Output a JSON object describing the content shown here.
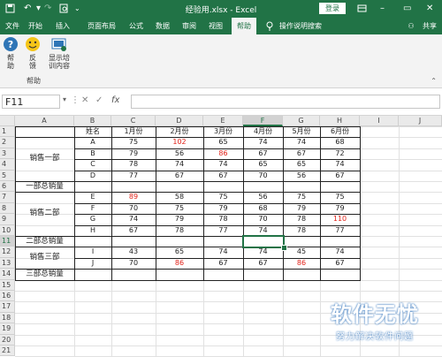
{
  "window": {
    "title": "经验用.xlsx  -  Excel",
    "login_label": "登录",
    "icons": [
      "save-icon",
      "undo-icon",
      "redo-icon",
      "print-preview-icon",
      "customize-icon"
    ]
  },
  "menu": {
    "tabs": [
      "文件",
      "开始",
      "插入",
      "页面布局",
      "公式",
      "数据",
      "审阅",
      "视图",
      "帮助",
      "操作说明搜索"
    ],
    "active": "帮助",
    "share_label": "共享"
  },
  "ribbon": {
    "buttons": [
      {
        "label": "帮\n助",
        "icon": "help-icon"
      },
      {
        "label": "反\n馈",
        "icon": "smiley-icon"
      },
      {
        "label": "显示培\n训内容",
        "icon": "training-icon"
      }
    ],
    "group_label": "帮助"
  },
  "formula_bar": {
    "name_box": "F11",
    "fx_label": "fx",
    "value": ""
  },
  "grid": {
    "columns": [
      "A",
      "B",
      "C",
      "D",
      "E",
      "F",
      "G",
      "H",
      "I",
      "J"
    ],
    "selected_column": "F",
    "rows": [
      "1",
      "2",
      "3",
      "4",
      "5",
      "6",
      "7",
      "8",
      "9",
      "10",
      "11",
      "12",
      "13",
      "14",
      "15",
      "16",
      "17",
      "18",
      "19",
      "20",
      "21"
    ],
    "selected_row": "11",
    "selected_cell": "F11"
  },
  "table": {
    "header": [
      "姓名",
      "1月份",
      "2月份",
      "3月份",
      "4月份",
      "5月份",
      "6月份"
    ],
    "departments": [
      {
        "name": "销售一部",
        "total_label": "一部总销量"
      },
      {
        "name": "销售二部",
        "total_label": "二部总销量"
      },
      {
        "name": "销售三部",
        "total_label": "三部总销量"
      }
    ],
    "rows": [
      {
        "r": 2,
        "name": "A",
        "values": [
          "75",
          "102",
          "65",
          "74",
          "74",
          "68"
        ],
        "red": [
          1
        ]
      },
      {
        "r": 3,
        "name": "B",
        "values": [
          "79",
          "56",
          "86",
          "67",
          "67",
          "72"
        ],
        "red": [
          2
        ]
      },
      {
        "r": 4,
        "name": "C",
        "values": [
          "78",
          "74",
          "74",
          "65",
          "65",
          "74"
        ],
        "red": []
      },
      {
        "r": 5,
        "name": "D",
        "values": [
          "77",
          "67",
          "67",
          "70",
          "56",
          "67"
        ],
        "red": []
      },
      {
        "r": 7,
        "name": "E",
        "values": [
          "89",
          "58",
          "75",
          "56",
          "75",
          "75"
        ],
        "red": [
          0
        ]
      },
      {
        "r": 8,
        "name": "F",
        "values": [
          "70",
          "75",
          "79",
          "68",
          "79",
          "79"
        ],
        "red": []
      },
      {
        "r": 9,
        "name": "G",
        "values": [
          "74",
          "79",
          "78",
          "70",
          "78",
          "110"
        ],
        "red": [
          5
        ]
      },
      {
        "r": 10,
        "name": "H",
        "values": [
          "67",
          "78",
          "77",
          "74",
          "78",
          "77"
        ],
        "red": []
      },
      {
        "r": 12,
        "name": "I",
        "values": [
          "43",
          "65",
          "74",
          "74",
          "45",
          "74"
        ],
        "red": []
      },
      {
        "r": 13,
        "name": "J",
        "values": [
          "70",
          "86",
          "67",
          "67",
          "86",
          "67"
        ],
        "red": [
          1,
          4
        ]
      }
    ]
  },
  "colors": {
    "excel_green": "#217346",
    "red_value": "#e2231a"
  },
  "watermark": {
    "title": "软件无忧",
    "subtitle": "努力解决软件问题"
  }
}
